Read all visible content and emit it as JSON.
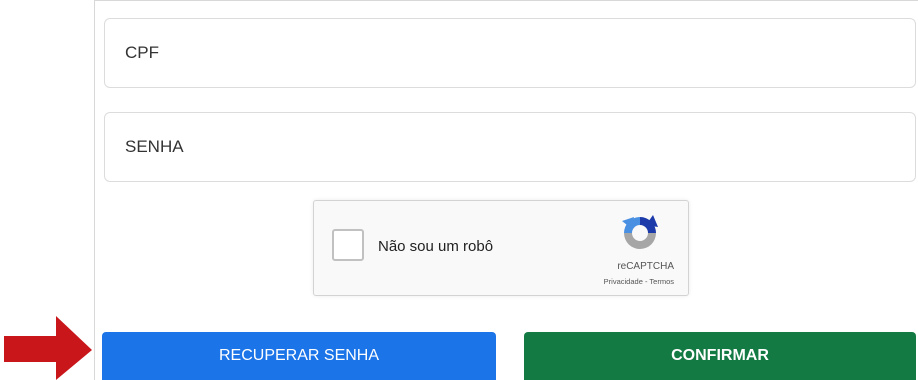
{
  "form": {
    "cpf_placeholder": "CPF",
    "cpf_value": "",
    "senha_placeholder": "SENHA",
    "senha_value": ""
  },
  "captcha": {
    "label": "Não sou um robô",
    "brand": "reCAPTCHA",
    "privacy": "Privacidade",
    "separator": " - ",
    "terms": "Termos",
    "checked": false,
    "logo_icon": "recaptcha-logo-icon"
  },
  "actions": {
    "recover_label": "RECUPERAR SENHA",
    "confirm_label": "CONFIRMAR"
  },
  "annotation": {
    "arrow_icon": "red-arrow-right-icon"
  },
  "colors": {
    "recover_button": "#1b74e8",
    "confirm_button": "#137a44",
    "arrow": "#c8161b",
    "captcha_blue": "#1c3aa9",
    "captcha_light_blue": "#4a90e2",
    "captcha_gray": "#a6a6a6"
  }
}
